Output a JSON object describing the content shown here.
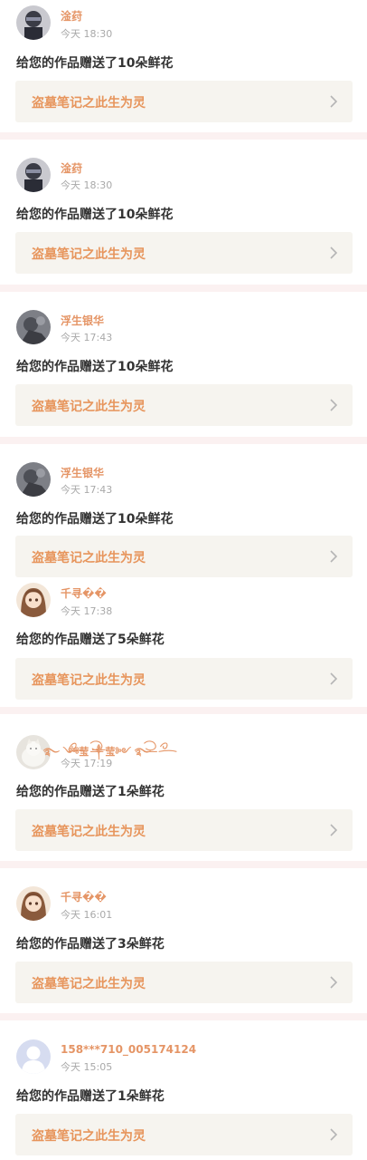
{
  "notifications": [
    {
      "user": "淦荮",
      "time": "今天 18:30",
      "message": "给您的作品赠送了10朵鲜花",
      "work": "盗墓笔记之此生为灵",
      "avatar": "dark-face-avatar"
    },
    {
      "user": "淦荮",
      "time": "今天 18:30",
      "message": "给您的作品赠送了10朵鲜花",
      "work": "盗墓笔记之此生为灵",
      "avatar": "dark-face-avatar"
    },
    {
      "user": "浮生银华",
      "time": "今天 17:43",
      "message": "给您的作品赠送了10朵鲜花",
      "work": "盗墓笔记之此生为灵",
      "avatar": "grey-figure-avatar"
    },
    {
      "user": "浮生银华",
      "time": "今天 17:43",
      "message": "给您的作品赠送了10朵鲜花",
      "work": "盗墓笔记之此生为灵",
      "avatar": "grey-figure-avatar"
    },
    {
      "user": "千寻��",
      "time": "今天 17:38",
      "message": "给您的作品赠送了5朵鲜花",
      "work": "盗墓笔记之此生为灵",
      "avatar": "anime-girl-avatar"
    },
    {
      "user": "࿐ ༺莹 ༒莹༻ ࿐",
      "time": "今天 17:19",
      "message": "给您的作品赠送了1朵鲜花",
      "work": "盗墓笔记之此生为灵",
      "avatar": "white-cat-avatar"
    },
    {
      "user": "千寻��",
      "time": "今天 16:01",
      "message": "给您的作品赠送了3朵鲜花",
      "work": "盗墓笔记之此生为灵",
      "avatar": "anime-girl-avatar"
    },
    {
      "user": "158***710_005174124",
      "time": "今天 15:05",
      "message": "给您的作品赠送了1朵鲜花",
      "work": "盗墓笔记之此生为灵",
      "avatar": "default-user-avatar"
    }
  ],
  "colors": {
    "username": "#e59566",
    "work_title": "#e7955c",
    "work_bg": "#f6f4ef",
    "time": "#a9a9a9",
    "message": "#333333",
    "separator": "#fbf1f1"
  }
}
